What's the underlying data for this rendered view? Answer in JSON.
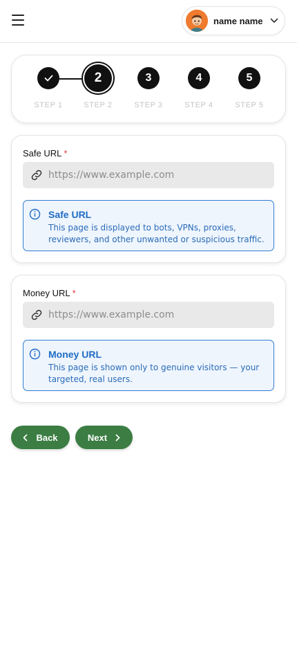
{
  "header": {
    "menu_icon": "hamburger-icon",
    "user": {
      "name": "name name",
      "avatar": "cartoon-avatar",
      "dropdown_icon": "chevron-down-icon"
    }
  },
  "stepper": {
    "steps": [
      {
        "label": "STEP 1",
        "number": "1",
        "status": "completed",
        "icon": "check-icon"
      },
      {
        "label": "STEP 2",
        "number": "2",
        "status": "active"
      },
      {
        "label": "STEP 3",
        "number": "3",
        "status": "pending"
      },
      {
        "label": "STEP 4",
        "number": "4",
        "status": "pending"
      },
      {
        "label": "STEP 5",
        "number": "5",
        "status": "pending"
      }
    ]
  },
  "safe_url": {
    "label": "Safe URL",
    "required_mark": "*",
    "placeholder": "https://www.example.com",
    "value": "",
    "icon": "link-icon",
    "info": {
      "icon": "info-icon",
      "title": "Safe URL",
      "description": "This page is displayed to bots, VPNs, proxies, reviewers, and other unwanted or suspicious traffic."
    }
  },
  "money_url": {
    "label": "Money URL",
    "required_mark": "*",
    "placeholder": "https://www.example.com",
    "value": "",
    "icon": "link-icon",
    "info": {
      "icon": "info-icon",
      "title": "Money URL",
      "description": "This page is shown only to genuine visitors — your targeted, real users."
    }
  },
  "actions": {
    "back_label": "Back",
    "next_label": "Next"
  },
  "colors": {
    "primary_button": "#3b7d43",
    "info_border": "#2f7bd1",
    "info_background": "#eef5fd",
    "required": "#e03b3b",
    "step_active": "#111111",
    "step_label_inactive": "#c4c4c4"
  }
}
